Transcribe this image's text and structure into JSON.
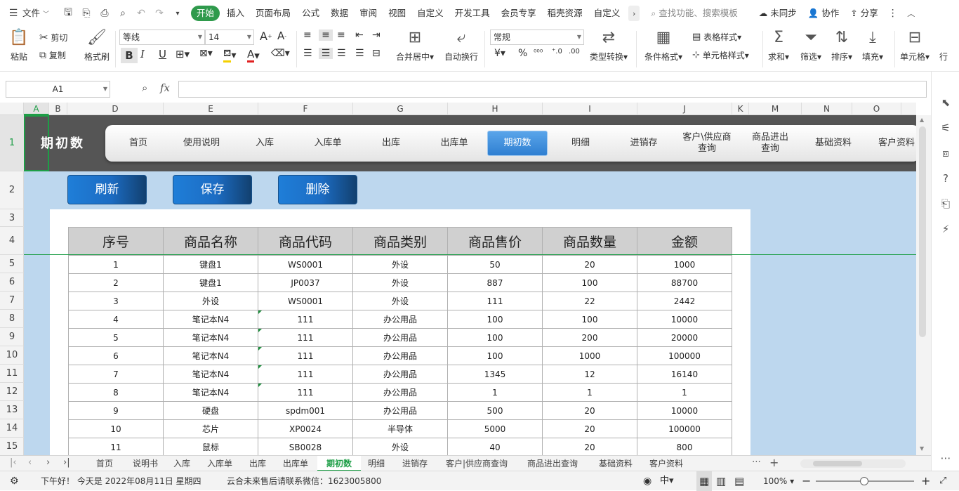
{
  "menubar": {
    "file_label": "文件",
    "tabs": [
      "开始",
      "插入",
      "页面布局",
      "公式",
      "数据",
      "审阅",
      "视图",
      "自定义",
      "开发工具",
      "会员专享",
      "稻壳资源",
      "自定义"
    ],
    "search_placeholder": "查找功能、搜索模板",
    "sync_label": "未同步",
    "collab_label": "协作",
    "share_label": "分享"
  },
  "ribbon": {
    "paste": "粘贴",
    "cut": "剪切",
    "copy": "复制",
    "format_painter": "格式刷",
    "font_name": "等线",
    "font_size": "14",
    "number_format": "常规",
    "merge_center": "合并居中",
    "wrap_text": "自动换行",
    "type_convert": "类型转换",
    "cond_format": "条件格式",
    "table_style": "表格样式",
    "cell_style": "单元格样式",
    "sum": "求和",
    "filter": "筛选",
    "sort": "排序",
    "fill": "填充",
    "cells": "单元格",
    "row_col": "行"
  },
  "formula": {
    "cell_ref": "A1",
    "fx": "fx",
    "value": ""
  },
  "columns": [
    "A",
    "B",
    "D",
    "E",
    "F",
    "G",
    "H",
    "I",
    "J",
    "K",
    "M",
    "N",
    "O"
  ],
  "rows": [
    "1",
    "2",
    "3",
    "4",
    "5",
    "6",
    "7",
    "8",
    "9",
    "10",
    "11",
    "12",
    "13",
    "14",
    "15"
  ],
  "sheet": {
    "title": "期初数",
    "nav": [
      "首页",
      "使用说明",
      "入库",
      "入库单",
      "出库",
      "出库单",
      "期初数",
      "明细",
      "进销存",
      "客户\\供应商查询",
      "商品进出查询",
      "基础资料",
      "客户资料"
    ],
    "nav_active_index": 6,
    "actions": [
      "刷新",
      "保存",
      "删除"
    ],
    "table_headers": [
      "序号",
      "商品名称",
      "商品代码",
      "商品类别",
      "商品售价",
      "商品数量",
      "金额"
    ],
    "table_rows": [
      [
        "1",
        "键盘1",
        "WS0001",
        "外设",
        "50",
        "20",
        "1000"
      ],
      [
        "2",
        "键盘1",
        "JP0037",
        "外设",
        "887",
        "100",
        "88700"
      ],
      [
        "3",
        "外设",
        "WS0001",
        "外设",
        "111",
        "22",
        "2442"
      ],
      [
        "4",
        "笔记本N4",
        "111",
        "办公用品",
        "100",
        "100",
        "10000"
      ],
      [
        "5",
        "笔记本N4",
        "111",
        "办公用品",
        "100",
        "200",
        "20000"
      ],
      [
        "6",
        "笔记本N4",
        "111",
        "办公用品",
        "100",
        "1000",
        "100000"
      ],
      [
        "7",
        "笔记本N4",
        "111",
        "办公用品",
        "1345",
        "12",
        "16140"
      ],
      [
        "8",
        "笔记本N4",
        "111",
        "办公用品",
        "1",
        "1",
        "1"
      ],
      [
        "9",
        "硬盘",
        "spdm001",
        "办公用品",
        "500",
        "20",
        "10000"
      ],
      [
        "10",
        "芯片",
        "XP0024",
        "半导体",
        "5000",
        "20",
        "100000"
      ],
      [
        "11",
        "鼠标",
        "SB0028",
        "外设",
        "40",
        "20",
        "800"
      ]
    ]
  },
  "sheet_tabs": [
    "首页",
    "说明书",
    "入库",
    "入库单",
    "出库",
    "出库单",
    "期初数",
    "明细",
    "进销存",
    "客户|供应商查询",
    "商品进出查询",
    "基础资料",
    "客户资料"
  ],
  "active_sheet_tab": 6,
  "status": {
    "greeting": "下午好！ 今天是 2022年08月11日 星期四",
    "message": "云合未来售后请联系微信：1623005800",
    "zoom": "100%"
  },
  "colors": {
    "accent": "#2f9a4c",
    "sheet_bg": "#bdd7ee",
    "nav_dark": "#555555",
    "button_blue": "#1f7ed8"
  }
}
